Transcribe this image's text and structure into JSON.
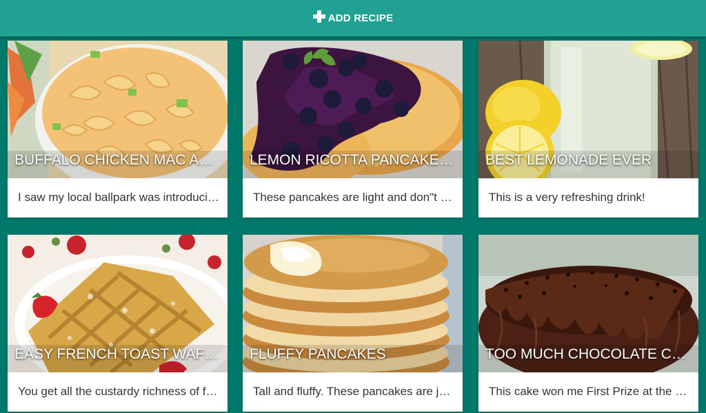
{
  "toolbar": {
    "add_label": "ADD RECIPE",
    "icon": "plus-icon"
  },
  "recipes": [
    {
      "title": "BUFFALO CHICKEN MAC AND CHEESE",
      "description": "I saw my local ballpark was introducing a new dish",
      "image": "mac-and-cheese"
    },
    {
      "title": "LEMON RICOTTA PANCAKES WITH BLUEBERRY SAUCE",
      "description": "These pancakes are light and don\"t need syrup",
      "image": "blueberry-pancakes"
    },
    {
      "title": "BEST LEMONADE EVER",
      "description": "This is a very refreshing drink!",
      "image": "lemonade"
    },
    {
      "title": "EASY FRENCH TOAST WAFFLES",
      "description": "You get all the custardy richness of french toast",
      "image": "waffles"
    },
    {
      "title": "FLUFFY PANCAKES",
      "description": "Tall and fluffy. These pancakes are just right",
      "image": "pancake-stack"
    },
    {
      "title": "TOO MUCH CHOCOLATE CAKE",
      "description": "This cake won me First Prize at the state fair",
      "image": "chocolate-cake"
    }
  ]
}
